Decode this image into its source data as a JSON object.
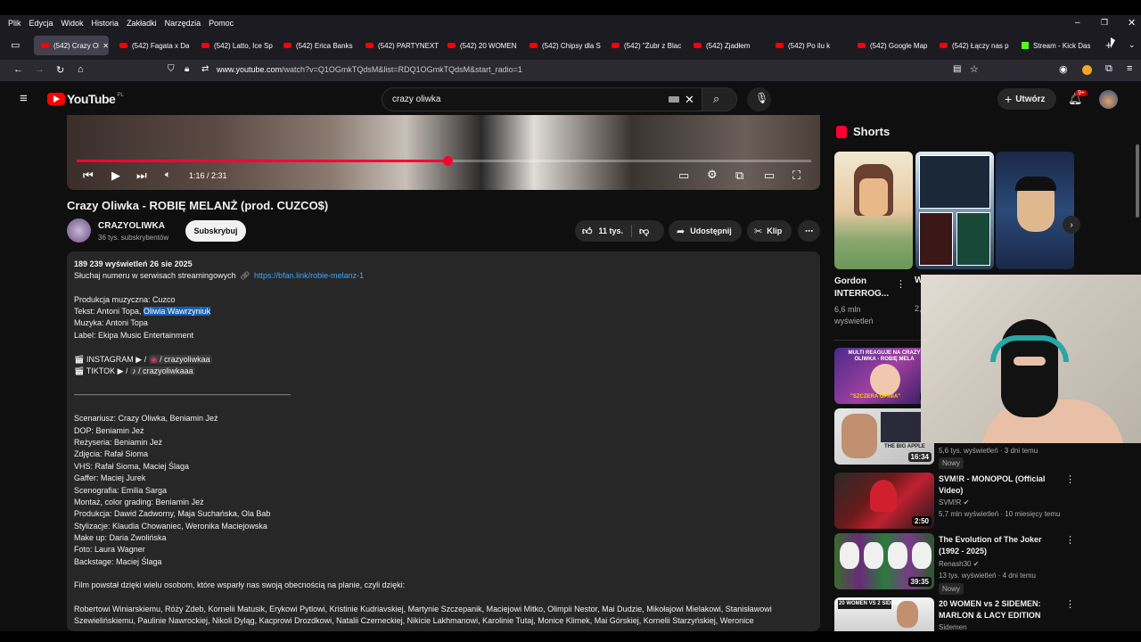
{
  "menu": [
    "Plik",
    "Edycja",
    "Widok",
    "Historia",
    "Zakładki",
    "Narzędzia",
    "Pomoc"
  ],
  "tabs": [
    {
      "label": "(542) Crazy Oli",
      "active": true,
      "kind": "yt"
    },
    {
      "label": "(542) Fagata x Da",
      "kind": "yt"
    },
    {
      "label": "(542) Latto, Ice Sp",
      "kind": "yt"
    },
    {
      "label": "(542) Erica Banks",
      "kind": "yt"
    },
    {
      "label": "(542) PARTYNEXT",
      "kind": "yt"
    },
    {
      "label": "(542) 20 WOMEN",
      "kind": "yt"
    },
    {
      "label": "(542) Chipsy dla S",
      "kind": "yt"
    },
    {
      "label": "(542) \"Żubr z Blac",
      "kind": "yt"
    },
    {
      "label": "(542) Zjadłem",
      "kind": "yt"
    },
    {
      "label": "(542) Po ilu k",
      "kind": "yt"
    },
    {
      "label": "(542) Google Map",
      "kind": "yt"
    },
    {
      "label": "(542) Łączy nas p",
      "kind": "yt"
    },
    {
      "label": "Stream - Kick Das",
      "kind": "kick"
    }
  ],
  "url": {
    "domain": "www.youtube.com",
    "path": "/watch?v=Q1OGmkTQdsM&list=RDQ1OGmkTQdsM&start_radio=1"
  },
  "yt": {
    "logo": "YouTube",
    "region": "PL",
    "search_value": "crazy oliwka",
    "create_label": "Utwórz",
    "notif_count": "9+"
  },
  "player": {
    "time": "1:16 / 2:31",
    "progress": 0.505
  },
  "video": {
    "title": "Crazy Oliwka - ROBIĘ MELANŻ (prod. CUZCO$)",
    "channel": "CRAZYOLIWKA",
    "subs": "36 tys. subskrybentów",
    "subscribe": "Subskrybuj",
    "likes": "11 tys.",
    "share": "Udostępnij",
    "clip": "Klip"
  },
  "description": {
    "views_date": "189 239 wyświetleń  26 sie 2025",
    "stream_text": "Słuchaj numeru w serwisach streamingowych",
    "stream_link": "https://bfan.link/robie-melanz-1",
    "prod": "Produkcja muzyczna: Cuzco",
    "text_prefix": "Tekst: Antoni Topa,",
    "text_highlight": "Oliwia Wawrzyniuk",
    "music": "Muzyka: Antoni Topa",
    "label": "Label: Ekipa Music Entertainment",
    "instagram_prefix": "INSTAGRAM ▶ /",
    "instagram_handle": "/ crazyoliwkaa",
    "tiktok_prefix": "TIKTOK ▶ /",
    "tiktok_handle": "/ crazyoliwkaaa",
    "divider": "———————————————————————————",
    "credits": [
      "Scenariusz: Crazy Oliwka, Beniamin Jeż",
      "DOP: Beniamin Jeż",
      "Reżyseria: Beniamin Jeż",
      "Zdjęcia: Rafał Sioma",
      "VHS: Rafał Sioma, Maciej Ślaga",
      "Gaffer: Maciej Jurek",
      "Scenografia: Emilia Sarga",
      "Montaż, color grading: Beniamin Jeż",
      "Produkcja: Dawid Zadworny, Maja Suchańska, Ola Bab",
      "Stylizacje: Klaudia Chowaniec, Weronika Maciejowska",
      "Make up: Daria Zwolińska",
      "Foto: Laura Wagner",
      "Backstage: Maciej Ślaga"
    ],
    "thanks": "Film powstał dzięki wielu osobom, które wsparły nas swoją obecnością na planie, czyli dzięki:",
    "names1": "Robertowi Winiarskiemu, Róży Zdeb, Kornelii Matusik, Erykowi Pytlowi, Kristinie Kudriavskiej, Martynie Szczepanik, Maciejowi Mitko, Olimpii Nestor, Mai Dudzie, Mikołajowi Mielakowi, Stanisławowi",
    "names2": "Szewielińskiemu, Paulinie Nawrockiej, Nikoli Dyląg, Kacprowi Drozdkowi, Natalii Czerneckiej, Nikicie Lakhmanowi, Karolinie Tutaj, Monice Klimek, Mai Górskiej, Kornelii Starzyńskiej, Weronice"
  },
  "shorts": {
    "heading": "Shorts",
    "items": [
      {
        "title1": "Gordon",
        "title2": "INTERROG...",
        "views1": "6,6 mln",
        "views2": "wyświetleń"
      },
      {
        "title1": "W",
        "title2": "",
        "views1": "2,",
        "views2": ""
      }
    ]
  },
  "recommended": [
    {
      "title": "",
      "meta": "5,6 tys. wyświetleń · 3 dni temu",
      "badge": "Nowy",
      "duration": "9:"
    },
    {
      "title": "",
      "meta": "",
      "badge": "",
      "duration": "16:34"
    },
    {
      "title": "SVM!R - MONOPOL (Official Video)",
      "channel": "SVM!R",
      "meta": "5,7 mln wyświetleń · 10 miesięcy temu",
      "duration": "2:50"
    },
    {
      "title": "The Evolution of The Joker (1992 - 2025)",
      "channel": "Renash30",
      "meta": "13 tys. wyświetleń · 4 dni temu",
      "badge": "Nowy",
      "duration": "39:35"
    },
    {
      "title": "20 WOMEN vs 2 SIDEMEN: MARLON & LACY EDITION",
      "channel": "Sidemen"
    }
  ],
  "thumb_texts": {
    "multi": "MULTI REAGUJE NA CRAZY OLIWKA - ROBIĘ MELA",
    "opinia": "\"SZCZERA OPINIA\"",
    "apple": "THE BIG APPLE",
    "sidemen": "20 WOMEN VS 2 SIDEMEN"
  }
}
